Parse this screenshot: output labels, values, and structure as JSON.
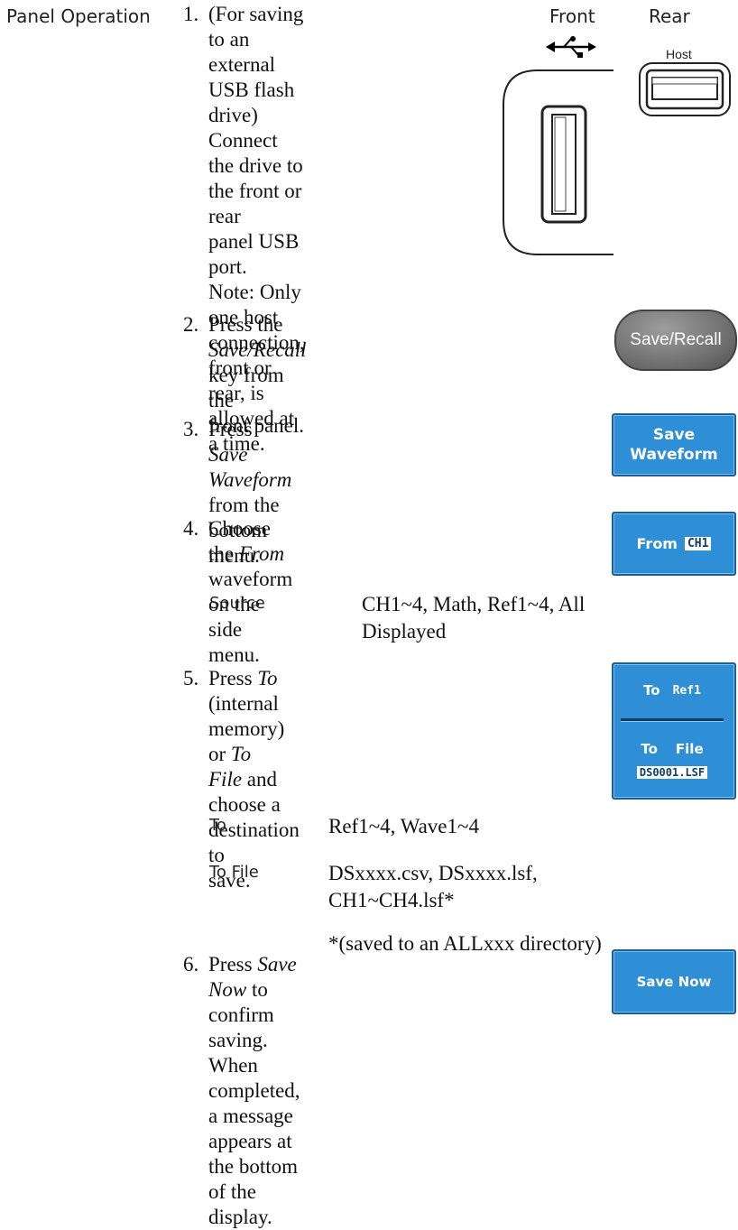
{
  "section": {
    "label": "Panel Operation"
  },
  "steps": [
    {
      "num": "1.",
      "lines": [
        "(For saving to an external",
        "USB flash drive) Connect",
        "the drive to the front or rear",
        "panel USB port.",
        "Note: Only one host",
        "connection, front or rear, is",
        "allowed at a time."
      ]
    },
    {
      "num": "2.",
      "pre": "Press the ",
      "em": "Save/Recall",
      "post": " key from the",
      "line2": "front panel."
    },
    {
      "num": "3.",
      "pre": "Press ",
      "em": "Save Waveform",
      "post": " from the",
      "line2": "bottom menu."
    },
    {
      "num": "4.",
      "pre": "Choose the ",
      "em": "From",
      "post": " waveform on the",
      "line2": "side menu."
    },
    {
      "num": "5.",
      "l1_pre": "Press ",
      "l1_em1": "To",
      "l1_mid": " (internal memory) or ",
      "l1_em2": "To",
      "l2_em": "File",
      "l2_post": " and choose a destination to",
      "line3": "save."
    },
    {
      "num": "6.",
      "pre": "Press ",
      "em": "Save Now",
      "post": " to confirm saving.",
      "line2": "When completed, a message",
      "line3": "appears at the bottom of the",
      "line4": "display."
    }
  ],
  "usb_figure": {
    "front_label": "Front",
    "rear_label": "Rear",
    "host_label": "Host"
  },
  "keys": {
    "save_recall": "Save/Recall",
    "save_waveform_1": "Save",
    "save_waveform_2": "Waveform",
    "from_label": "From",
    "from_value": "CH1",
    "to_label": "To",
    "to_value": "Ref1",
    "to_file_label_1": "To",
    "to_file_label_2": "File",
    "to_file_value": "DS0001.LSF",
    "save_now": "Save Now"
  },
  "params": {
    "source": {
      "key": "Source",
      "value_1": "CH1~4, Math, Ref1~4, All",
      "value_2": "Displayed"
    },
    "to": {
      "key": "To",
      "value": "Ref1~4, Wave1~4"
    },
    "to_file": {
      "key": "To File",
      "value_1": "DSxxxx.csv, DSxxxx.lsf,",
      "value_2": "CH1~CH4.lsf*",
      "note": "*(saved to an ALLxxx directory)"
    }
  }
}
